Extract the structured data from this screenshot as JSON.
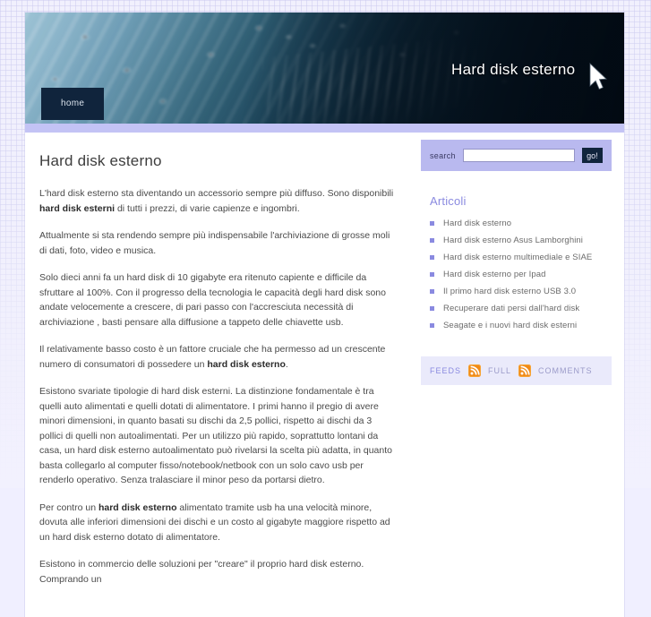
{
  "site": {
    "title": "Hard disk esterno",
    "nav": [
      {
        "label": "home"
      }
    ]
  },
  "article": {
    "heading": "Hard disk esterno",
    "paragraphs": [
      "L'hard disk esterno sta diventando un accessorio sempre più diffuso. Sono disponibili <b>hard disk esterni</b> di tutti i prezzi, di varie capienze e ingombri.",
      "Attualmente si sta rendendo sempre più indispensabile l'archiviazione di grosse moli di dati, foto, video e musica.",
      "Solo dieci anni fa un hard disk di 10 gigabyte era ritenuto capiente e difficile da sfruttare al 100%. Con il progresso della tecnologia le capacità degli hard disk sono andate velocemente a crescere, di pari passo con l'accresciuta necessità di archiviazione , basti pensare alla diffusione a tappeto delle chiavette usb.",
      "Il relativamente basso costo è un fattore  cruciale che ha permesso ad un crescente numero di consumatori di possedere un <b>hard disk esterno</b>.",
      "Esistono svariate tipologie di hard disk esterni. La distinzione fondamentale è tra quelli auto alimentati e quelli dotati di alimentatore. I primi hanno il pregio di avere  minori dimensioni, in quanto basati su dischi da 2,5 pollici, rispetto ai dischi da 3 pollici di quelli non autoalimentati. Per un utilizzo più rapido, soprattutto lontani da casa, un hard disk esterno autoalimentato  può rivelarsi la scelta più adatta, in quanto basta collegarlo al computer fisso/notebook/netbook con un solo cavo usb per renderlo operativo. Senza tralasciare il minor peso da portarsi dietro.",
      "Per contro un <b>hard disk esterno</b> alimentato tramite usb ha una velocità minore, dovuta alle inferiori dimensioni dei dischi e un costo al gigabyte maggiore rispetto ad un hard disk esterno dotato di alimentatore.",
      "Esistono in commercio delle soluzioni per \"creare\" il proprio hard disk esterno. Comprando un"
    ]
  },
  "search": {
    "label": "search",
    "value": "",
    "placeholder": "",
    "button_label": "go!"
  },
  "sidebar": {
    "articles_title": "Articoli",
    "articles": [
      {
        "label": "Hard disk esterno"
      },
      {
        "label": "Hard disk esterno Asus Lamborghini"
      },
      {
        "label": "Hard disk esterno multimediale e SIAE"
      },
      {
        "label": "Hard disk esterno per Ipad"
      },
      {
        "label": "Il primo hard disk esterno USB 3.0"
      },
      {
        "label": "Recuperare dati persi dall'hard disk"
      },
      {
        "label": "Seagate e i nuovi hard disk esterni"
      }
    ],
    "feeds": {
      "label": "FEEDS",
      "full_label": "FULL",
      "comments_label": "COMMENTS"
    }
  },
  "colors": {
    "accent": "#8a8ae0",
    "nav_dark": "#10243c",
    "search_bg": "#b9b9ef",
    "feeds_bg": "#eaeafb",
    "rss_orange": "#f49a24",
    "page_bg": "#f1f0fd"
  }
}
